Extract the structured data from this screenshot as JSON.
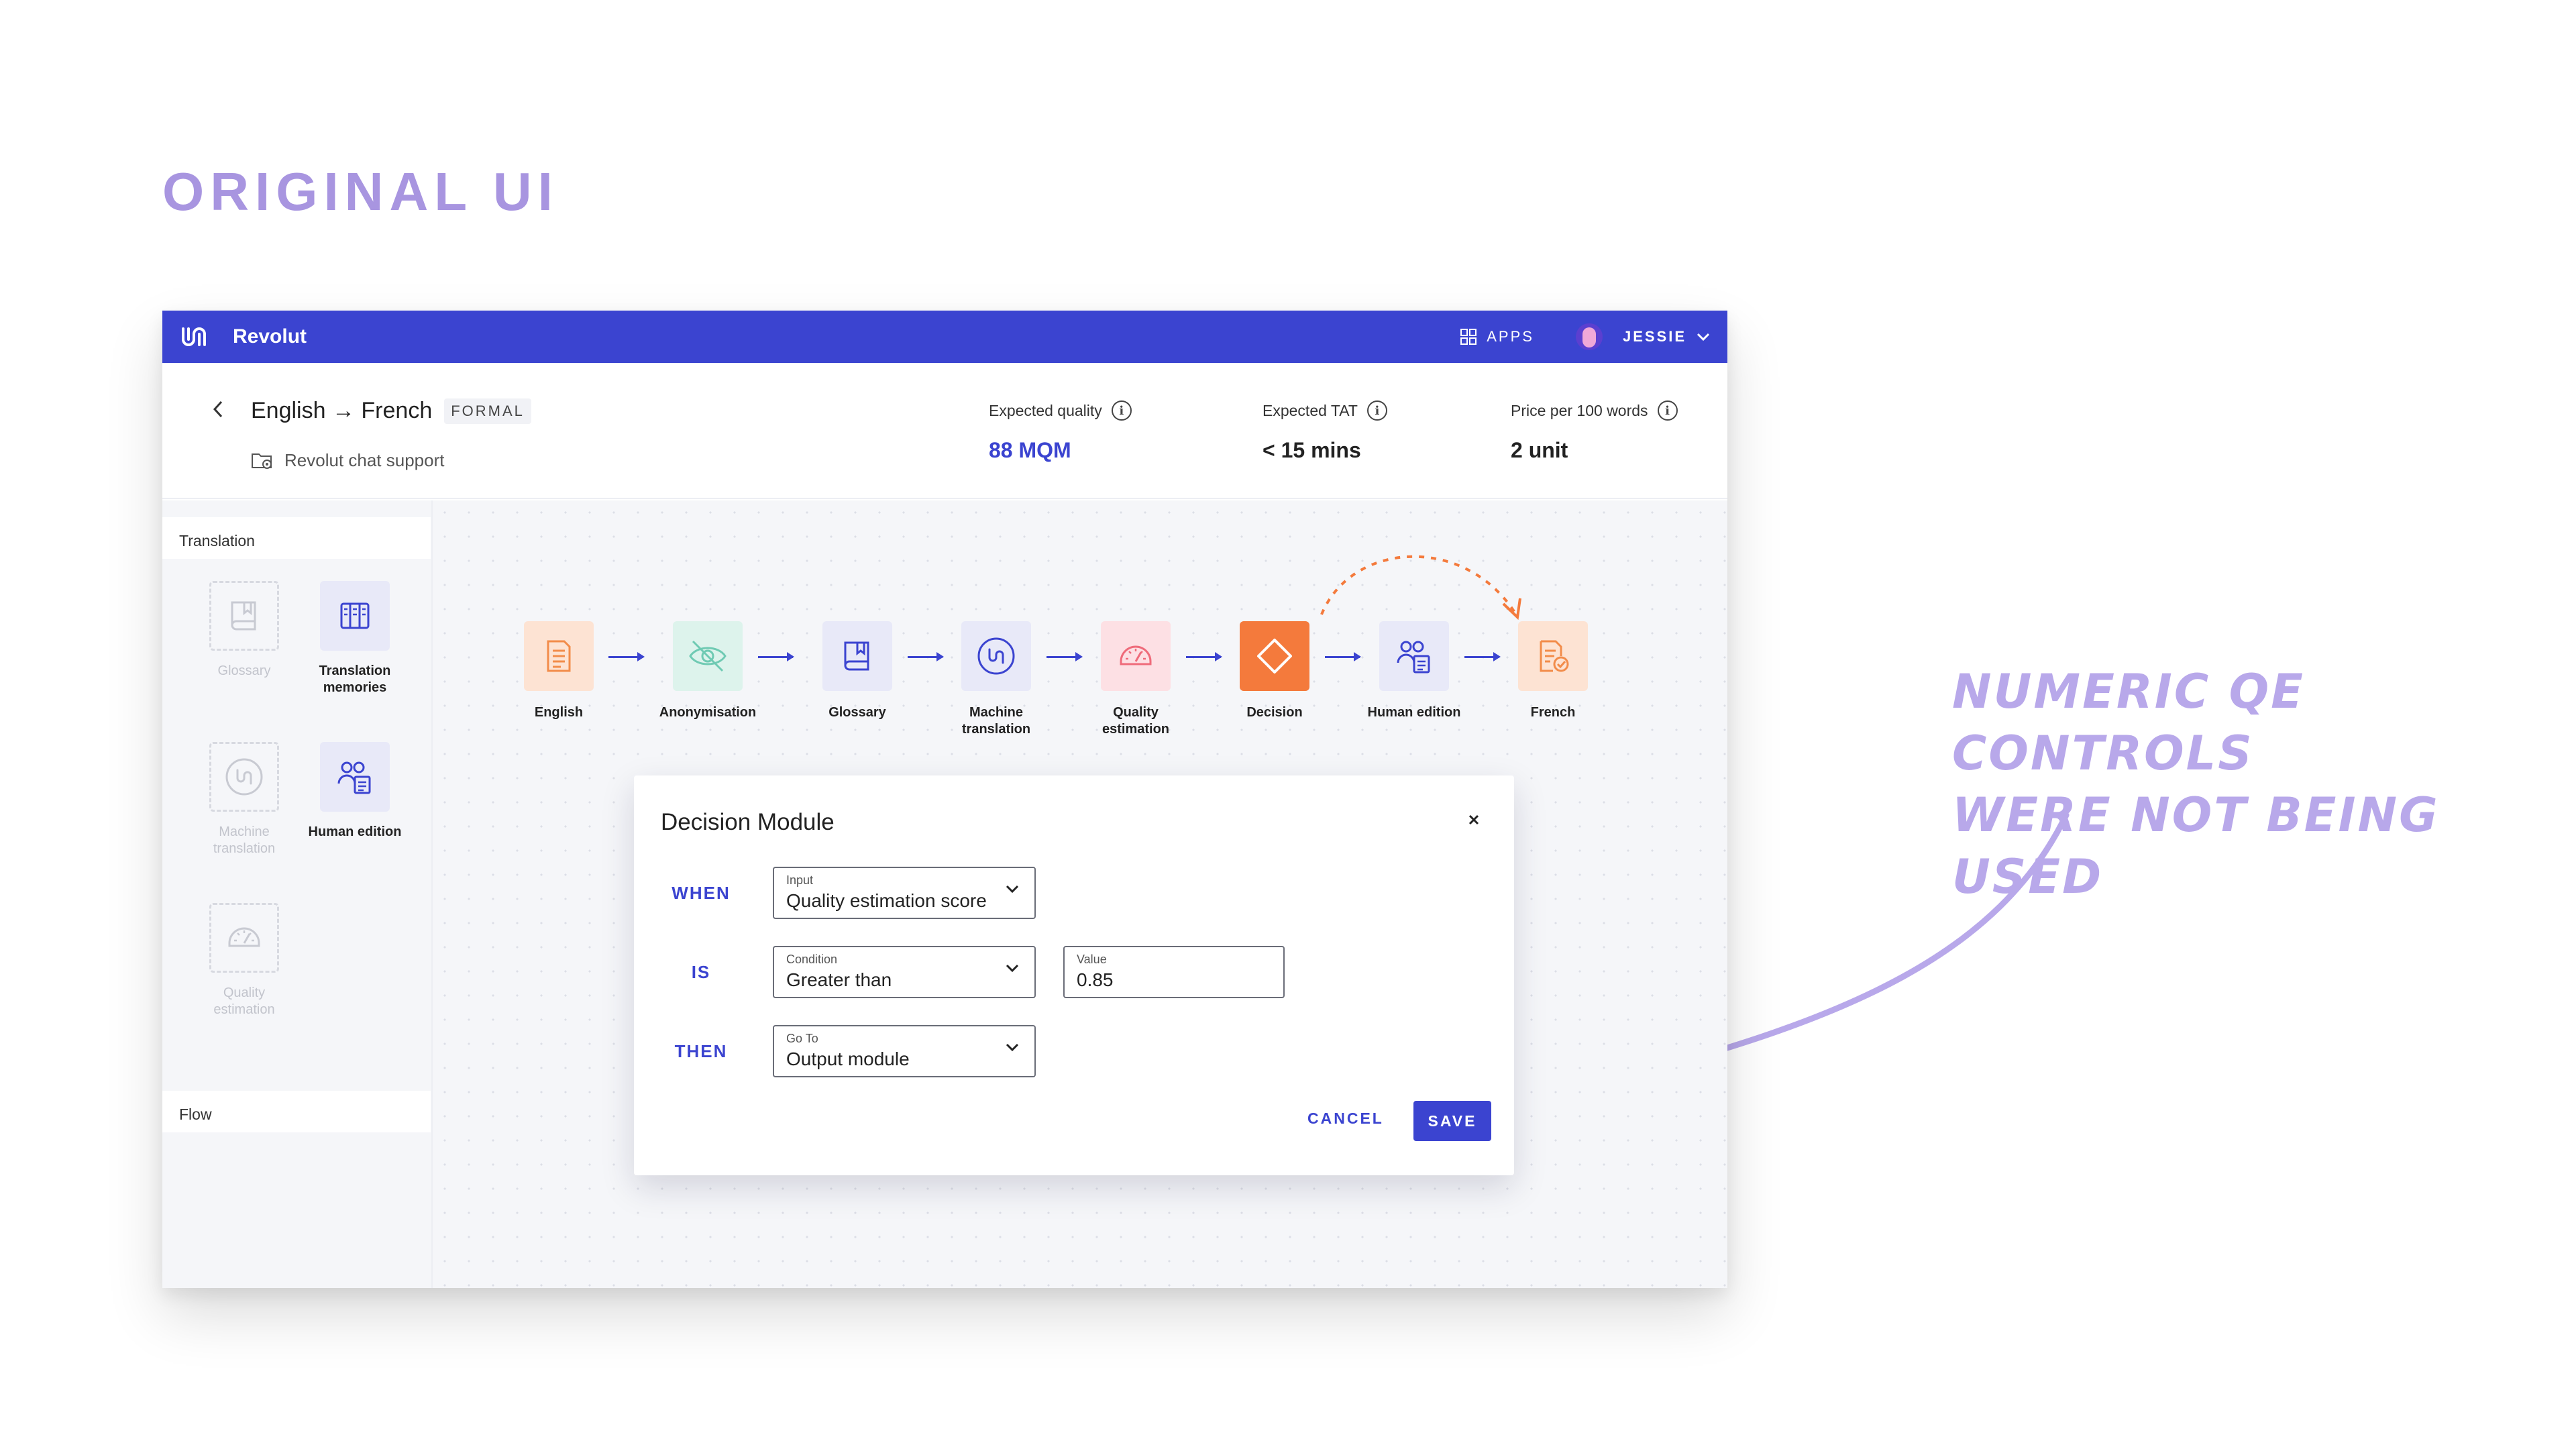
{
  "page": {
    "heading": "ORIGINAL UI",
    "annotation": [
      "NUMERIC QE CONTROLS",
      "WERE NOT BEING USED"
    ]
  },
  "topbar": {
    "brand": "Revolut",
    "apps_label": "APPS",
    "user_name": "JESSIE"
  },
  "header": {
    "route": "English → French",
    "badge": "FORMAL",
    "project": "Revolut chat support",
    "metrics": [
      {
        "label": "Expected quality",
        "value": "88 MQM",
        "color": "#3b44d0"
      },
      {
        "label": "Expected TAT",
        "value": "< 15 mins"
      },
      {
        "label": "Price per 100 words",
        "value": "2 unit"
      }
    ]
  },
  "sidebar": {
    "section_translation": "Translation",
    "section_flow": "Flow",
    "tools": [
      {
        "label": "Glossary",
        "icon": "book-icon",
        "enabled": false
      },
      {
        "label": "Translation memories",
        "icon": "database-icon",
        "enabled": true
      },
      {
        "label": "Machine translation",
        "icon": "unbabel-icon",
        "enabled": false
      },
      {
        "label": "Human edition",
        "icon": "people-edit-icon",
        "enabled": true
      },
      {
        "label": "Quality estimation",
        "icon": "gauge-icon",
        "enabled": false
      }
    ]
  },
  "pipeline": {
    "nodes": [
      {
        "label": "English",
        "icon": "document-icon",
        "color": "#f28c4a"
      },
      {
        "label": "Anonymisation",
        "icon": "eye-off-icon",
        "color": "#6fcab3"
      },
      {
        "label": "Glossary",
        "icon": "book-icon",
        "color": "#3b44d0"
      },
      {
        "label": "Machine translation",
        "icon": "unbabel-icon",
        "color": "#3b44d0"
      },
      {
        "label": "Quality estimation",
        "icon": "gauge-icon",
        "color": "#ef6b7a"
      },
      {
        "label": "Decision",
        "icon": "diamond-icon",
        "color": "#f47a3c"
      },
      {
        "label": "Human edition",
        "icon": "people-edit-icon",
        "color": "#3b44d0"
      },
      {
        "label": "French",
        "icon": "document-check-icon",
        "color": "#f28c4a"
      }
    ]
  },
  "modal": {
    "title": "Decision Module",
    "when_label": "WHEN",
    "is_label": "IS",
    "then_label": "THEN",
    "input": {
      "label": "Input",
      "value": "Quality estimation score"
    },
    "condition": {
      "label": "Condition",
      "value": "Greater than"
    },
    "value_field": {
      "label": "Value",
      "value": "0.85"
    },
    "goto": {
      "label": "Go To",
      "value": "Output module"
    },
    "cancel_label": "CANCEL",
    "save_label": "SAVE"
  }
}
